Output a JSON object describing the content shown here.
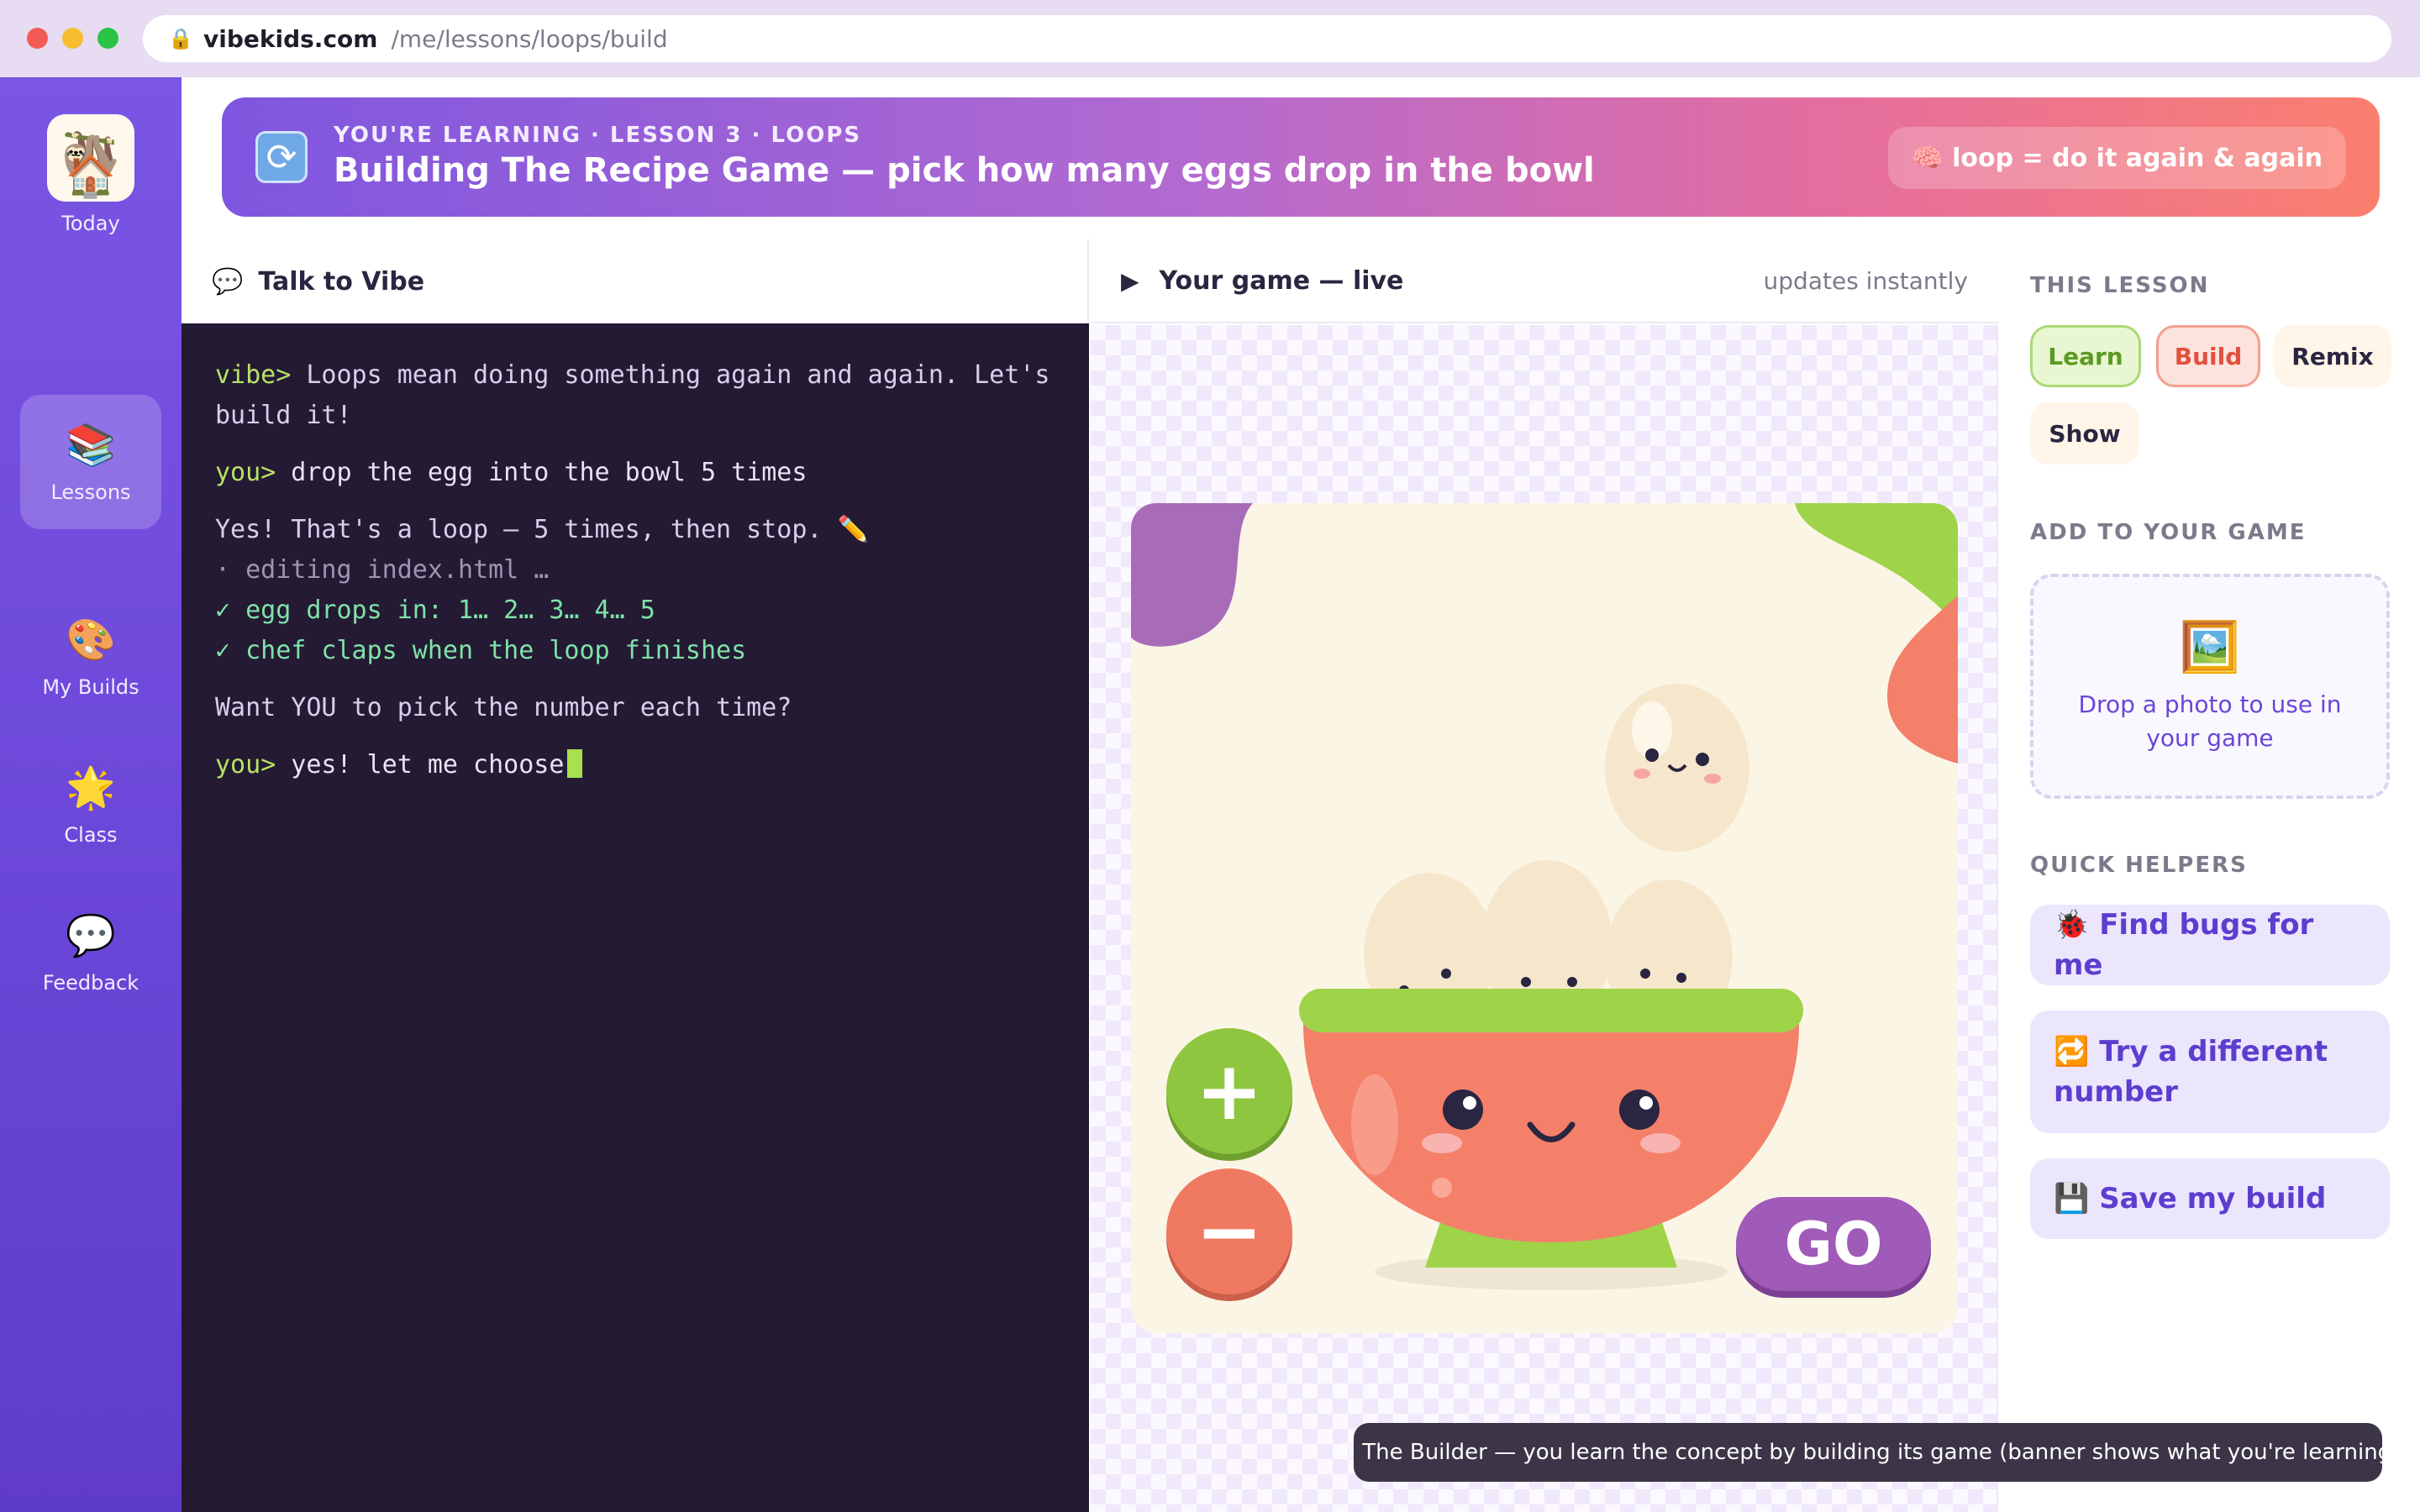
{
  "browser": {
    "domain": "vibekids.com",
    "path": "/me/lessons/loops/build"
  },
  "sidebar": {
    "logo_icon": "sloth-icon",
    "items": [
      {
        "label": "Today",
        "icon": "house-icon"
      },
      {
        "label": "Lessons",
        "icon": "books-icon",
        "active": true
      },
      {
        "label": "My Builds",
        "icon": "palette-icon"
      },
      {
        "label": "Class",
        "icon": "star-icon"
      },
      {
        "label": "Feedback",
        "icon": "speech-bubble-icon"
      }
    ]
  },
  "banner": {
    "kicker": "YOU'RE LEARNING · LESSON 3 · LOOPS",
    "title": "Building The Recipe Game — pick how many eggs drop in the bowl",
    "chip": "🧠 loop = do it again & again",
    "icon": "repeat-icon"
  },
  "chat": {
    "title": "Talk to Vibe",
    "lines": {
      "l1_prompt": "vibe>",
      "l1_text": " Loops mean doing something again and again. Let's build it!",
      "l2_prompt": "you>",
      "l2_text": " drop the egg into the bowl 5 times",
      "l3_text": "Yes! That's a loop — 5 times, then stop. ✏️",
      "l4_text": "· editing index.html …",
      "l5_text": "✓ egg drops in: 1… 2… 3… 4… 5",
      "l6_text": "✓ chef claps when the loop finishes",
      "l7_text": "Want YOU to pick the number each time?",
      "l8_prompt": "you>",
      "l8_text": " yes! let me choose"
    }
  },
  "game": {
    "title": "Your game — live",
    "status": "updates instantly",
    "go_label": "GO",
    "plus_label": "+",
    "minus_label": "−"
  },
  "right_panel": {
    "this_lesson_title": "THIS LESSON",
    "steps": {
      "learn": "Learn",
      "build": "Build",
      "remix": "Remix",
      "show": "Show"
    },
    "add_title": "ADD TO YOUR GAME",
    "drop_text": "Drop a photo to use in your game",
    "drop_icon": "framed-picture-icon",
    "helpers_title": "QUICK HELPERS",
    "helpers": [
      {
        "icon": "🐞",
        "label": "Find bugs for me"
      },
      {
        "icon": "🔁",
        "label": "Try a different number"
      },
      {
        "icon": "💾",
        "label": "Save my build"
      }
    ]
  },
  "toast": "⑩ The Builder — you learn the concept by building its game (banner shows what you're learning)",
  "colors": {
    "sidebar": "#6a46d8",
    "terminal_bg": "#241a33",
    "accent": "#5a3fcf",
    "bowl": "#f4806a",
    "go_button": "#a05ab8"
  }
}
